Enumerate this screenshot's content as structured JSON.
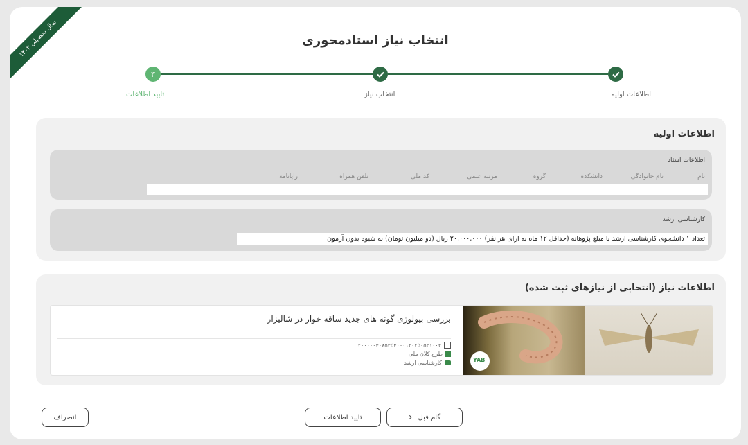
{
  "ribbon": {
    "text": "سال تحصیلی ۱۴۰۳"
  },
  "page": {
    "title": "انتخاب نیاز استادمحوری"
  },
  "steps": [
    {
      "label": "اطلاعات اولیه",
      "icon": "check-icon"
    },
    {
      "label": "انتخاب نیاز",
      "icon": "check-icon"
    },
    {
      "label": "تایید اطلاعات",
      "number": "۳"
    }
  ],
  "basic_info": {
    "title": "اطلاعات اولیه",
    "professor": {
      "title": "اطلاعات استاد",
      "columns": [
        "نام",
        "نام خانوادگی",
        "دانشکده",
        "گروه",
        "مرتبه علمی",
        "کد ملی",
        "تلفن همراه",
        "رایانامه"
      ]
    },
    "masters": {
      "title": "کارشناسی ارشد",
      "description": "تعداد ۱ دانشجوی کارشناسی ارشد با مبلغ پژوهانه (حداقل ۱۲ ماه به ازای هر نفر) ۲۰,۰۰۰,۰۰۰ ریال (دو میلیون تومان) به شیوه بدون آزمون"
    }
  },
  "need_info": {
    "title": "اطلاعات نیاز (انتخابی از نیازهای ثبت شده)",
    "item": {
      "title": "بررسی بیولوژی گونه های جدید ساقه خوار در شالیزار",
      "code": "۲۰۰۰۰۰۴۰۸۵۳۵۴۰۰۰۱۲۰۲۵۰۵۳۱۰۰۳",
      "plan": "طرح کلان ملی",
      "degree": "کارشناسی ارشد",
      "logo_text": "YAB"
    }
  },
  "buttons": {
    "prev": "گام قبل",
    "confirm": "تایید اطلاعات",
    "cancel": "انصراف"
  },
  "colors": {
    "primary": "#2e6b45",
    "active_step": "#5fb573",
    "ribbon": "#1d5c38"
  }
}
